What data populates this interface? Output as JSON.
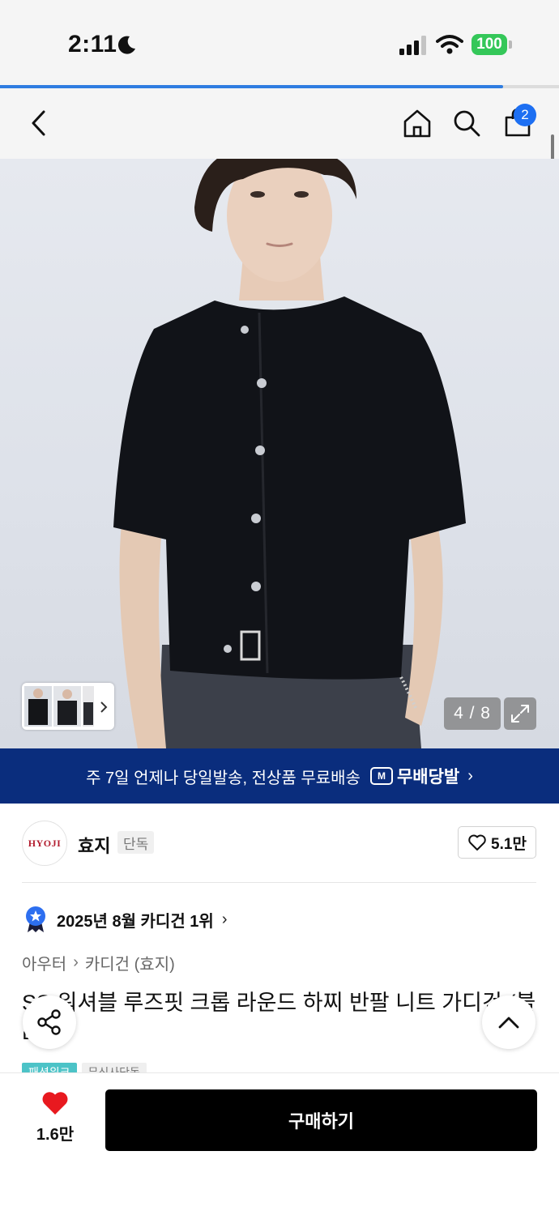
{
  "status": {
    "time": "2:11",
    "battery": "100"
  },
  "progress": {
    "fraction": 0.9
  },
  "nav": {
    "cart_count": "2"
  },
  "gallery": {
    "counter": "4 / 8"
  },
  "promo": {
    "text": "주 7일 언제나 당일발송, 전상품 무료배송",
    "logo_mark": "M",
    "logo_text": "무배당발",
    "chevron": "›"
  },
  "brand": {
    "logo_text": "HYOJI",
    "name": "효지",
    "tag": "단독",
    "likes": "5.1만"
  },
  "ranking": {
    "text": "2025년 8월 카디건 1위",
    "chevron": "›"
  },
  "category": {
    "parent": "아우터",
    "separator": "›",
    "child": "카디건 (효지)"
  },
  "product": {
    "title": "SS 워셔블 루즈핏 크롭 라운드 하찌 반팔 니트 가디건 (블러)"
  },
  "tags": [
    {
      "label": "패션위크"
    },
    {
      "label": "무신사단독"
    }
  ],
  "bottom": {
    "like_count": "1.6만",
    "buy_label": "구매하기"
  },
  "colors": {
    "accent": "#2f7de1",
    "promo_bg": "#0a2d7d",
    "badge": "#1d6ff2",
    "heart": "#e8191f",
    "tag_teal": "#4cc3c7"
  },
  "icons": [
    "moon-icon",
    "signal-icon",
    "wifi-icon",
    "back-icon",
    "home-icon",
    "search-icon",
    "cart-icon",
    "expand-icon",
    "heart-outline-icon",
    "ranking-badge-icon",
    "share-icon",
    "chevron-up-icon",
    "heart-filled-icon"
  ]
}
